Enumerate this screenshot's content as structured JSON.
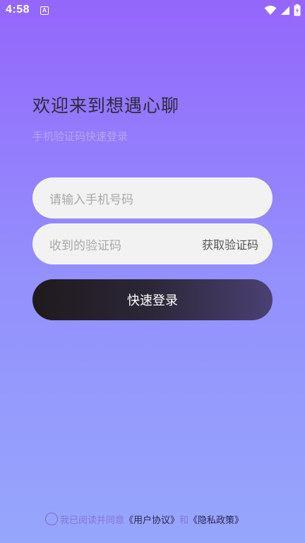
{
  "status_bar": {
    "time": "4:58",
    "notification_icon": "A",
    "icons": [
      "wifi-icon",
      "signal-icon",
      "battery-charging-icon"
    ]
  },
  "login": {
    "title": "欢迎来到想遇心聊",
    "subtitle": "手机验证码快速登录",
    "phone_placeholder": "请输入手机号码",
    "code_placeholder": "收到的验证码",
    "get_code_label": "获取验证码",
    "login_button": "快速登录"
  },
  "agreement": {
    "prefix": "我已阅读并同意",
    "user_agreement": "《用户协议》",
    "and": "和",
    "privacy_policy": "《隐私政策》"
  },
  "colors": {
    "background_top": "#9466fb",
    "background_bottom": "#96a6fc",
    "input_bg": "#f2f2f2",
    "button_start": "#1e1a1c",
    "button_end": "#4a4173"
  }
}
